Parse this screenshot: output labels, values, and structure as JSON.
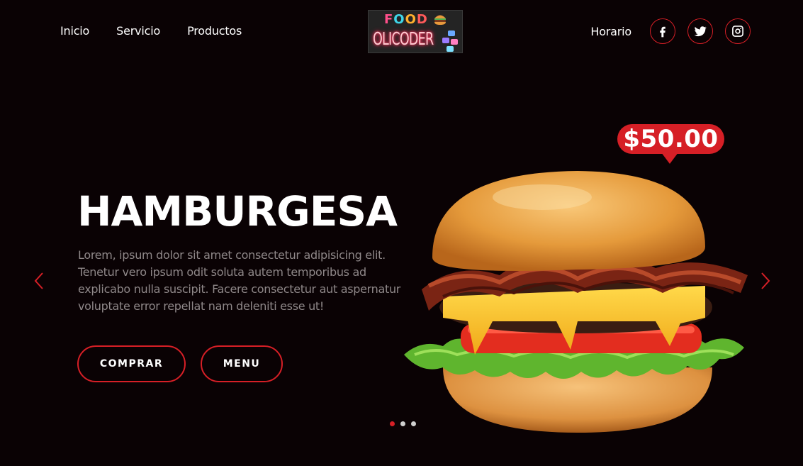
{
  "nav": {
    "left_links": [
      "Inicio",
      "Servicio",
      "Productos"
    ],
    "right_link": "Horario",
    "social_icons": [
      "facebook-icon",
      "twitter-icon",
      "instagram-icon"
    ]
  },
  "logo": {
    "top_text": [
      "F",
      "O",
      "O",
      "D"
    ],
    "bottom_text": "OLICODER"
  },
  "hero": {
    "title": "HAMBURGESA",
    "description": "Lorem, ipsum dolor sit amet consectetur adipisicing elit. Tenetur vero ipsum odit soluta autem temporibus ad explicabo nulla suscipit. Facere consectetur aut aspernatur voluptate error repellat nam deleniti esse ut!",
    "buttons": {
      "buy": "COMPRAR",
      "menu": "MENU"
    },
    "price": "$50.00"
  },
  "slider": {
    "slides": 3,
    "active": 1
  },
  "colors": {
    "accent": "#d61f26",
    "background": "#0a0204",
    "muted_text": "#8f8889"
  }
}
